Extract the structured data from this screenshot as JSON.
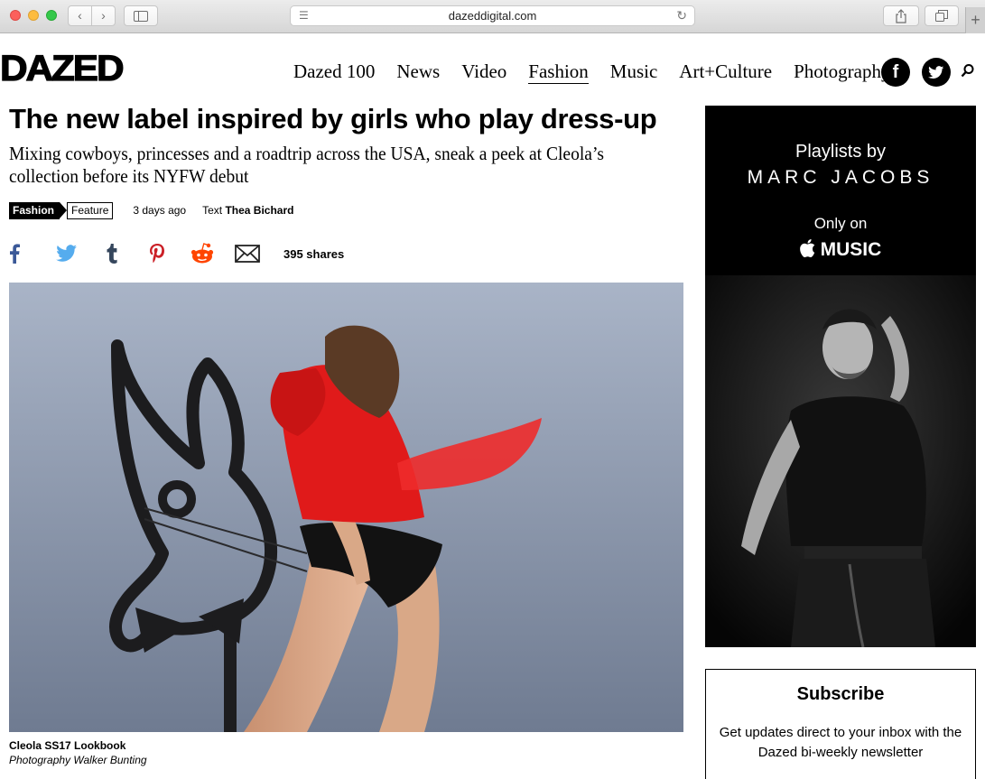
{
  "browser": {
    "url": "dazeddigital.com",
    "new_tab": "+"
  },
  "site": {
    "logo": "DAZED",
    "nav": [
      "Dazed 100",
      "News",
      "Video",
      "Fashion",
      "Music",
      "Art+Culture",
      "Photography"
    ],
    "active_nav": "Fashion",
    "social": {
      "facebook": "f"
    }
  },
  "article": {
    "headline": "The new label inspired by girls who play dress-up",
    "standfirst": "Mixing cowboys, princesses and a roadtrip across the USA, sneak a peek at Cleola’s collection before its NYFW debut",
    "tags": {
      "primary": "Fashion",
      "secondary": "Feature"
    },
    "date": "3 days ago",
    "byline_prefix": "Text",
    "author": "Thea Bichard",
    "shares": "395 shares",
    "caption_title": "Cleola SS17 Lookbook",
    "caption_credit": "Photography Walker Bunting"
  },
  "ad": {
    "line1": "Playlists by",
    "brand": "MARC JACOBS",
    "line3": "Only on",
    "service": "MUSIC"
  },
  "subscribe": {
    "title": "Subscribe",
    "text": "Get updates direct to your inbox with the Dazed bi-weekly newsletter"
  },
  "colors": {
    "facebook": "#3b5998",
    "twitter": "#55acee",
    "tumblr": "#35465c",
    "pinterest": "#cb2027",
    "reddit": "#ff4500",
    "dress_red": "#e01a1a"
  }
}
